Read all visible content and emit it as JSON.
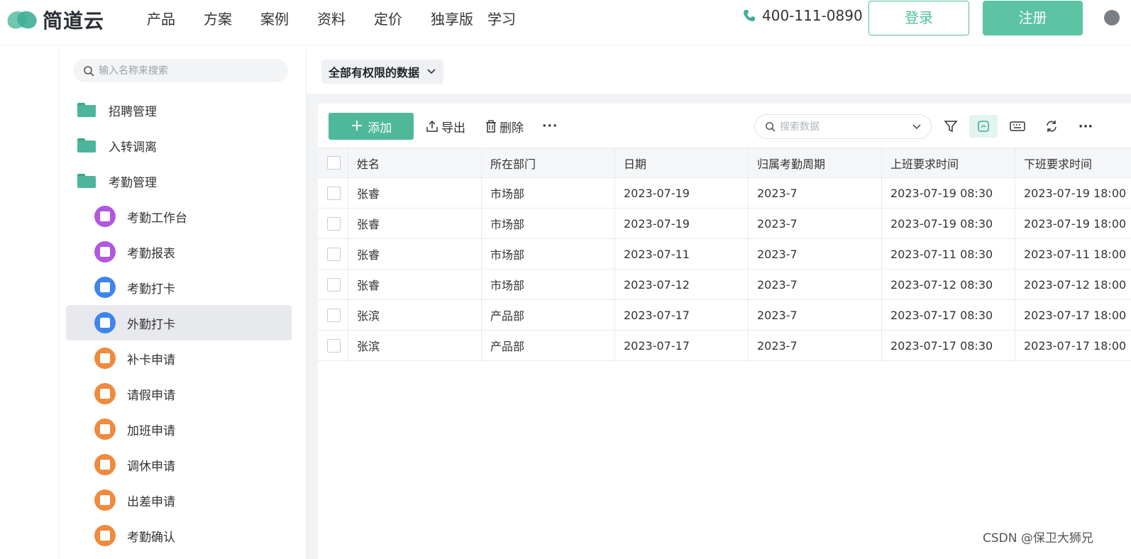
{
  "brand": {
    "name": "简道云"
  },
  "nav": {
    "items": [
      "产品",
      "方案",
      "案例",
      "资料",
      "定价",
      "独享版",
      "学习"
    ]
  },
  "phone": "400-111-0890",
  "auth": {
    "login": "登录",
    "register": "注册"
  },
  "sidebar": {
    "search_placeholder": "输入名称来搜索",
    "folders": [
      "招聘管理",
      "入转调离",
      "考勤管理"
    ],
    "apps": [
      {
        "label": "考勤工作台",
        "icon": "chart-icon",
        "color": "#b257e0"
      },
      {
        "label": "考勤报表",
        "icon": "chart-icon",
        "color": "#b257e0"
      },
      {
        "label": "考勤打卡",
        "icon": "form-icon",
        "color": "#3f86ec"
      },
      {
        "label": "外勤打卡",
        "icon": "form-icon",
        "color": "#3f86ec",
        "active": true
      },
      {
        "label": "补卡申请",
        "icon": "flow-icon",
        "color": "#f08a3c"
      },
      {
        "label": "请假申请",
        "icon": "flow-icon",
        "color": "#f08a3c"
      },
      {
        "label": "加班申请",
        "icon": "flow-icon",
        "color": "#f08a3c"
      },
      {
        "label": "调休申请",
        "icon": "flow-icon",
        "color": "#f08a3c"
      },
      {
        "label": "出差申请",
        "icon": "flow-icon",
        "color": "#f08a3c"
      },
      {
        "label": "考勤确认",
        "icon": "flow-icon",
        "color": "#f08a3c"
      }
    ]
  },
  "filter": {
    "label": "全部有权限的数据"
  },
  "toolbar": {
    "add": "添加",
    "export": "导出",
    "delete": "删除",
    "more": "···",
    "search_placeholder": "搜索数据"
  },
  "table": {
    "columns": [
      "姓名",
      "所在部门",
      "日期",
      "归属考勤周期",
      "上班要求时间",
      "下班要求时间"
    ],
    "rows": [
      [
        "张睿",
        "市场部",
        "2023-07-19",
        "2023-7",
        "2023-07-19 08:30",
        "2023-07-19 18:00"
      ],
      [
        "张睿",
        "市场部",
        "2023-07-19",
        "2023-7",
        "2023-07-19 08:30",
        "2023-07-19 18:00"
      ],
      [
        "张睿",
        "市场部",
        "2023-07-11",
        "2023-7",
        "2023-07-11 08:30",
        "2023-07-11 18:00"
      ],
      [
        "张睿",
        "市场部",
        "2023-07-12",
        "2023-7",
        "2023-07-12 08:30",
        "2023-07-12 18:00"
      ],
      [
        "张滨",
        "产品部",
        "2023-07-17",
        "2023-7",
        "2023-07-17 08:30",
        "2023-07-17 18:00"
      ],
      [
        "张滨",
        "产品部",
        "2023-07-17",
        "2023-7",
        "2023-07-17 08:30",
        "2023-07-17 18:00"
      ]
    ]
  },
  "watermark": "CSDN @保卫大狮兄"
}
